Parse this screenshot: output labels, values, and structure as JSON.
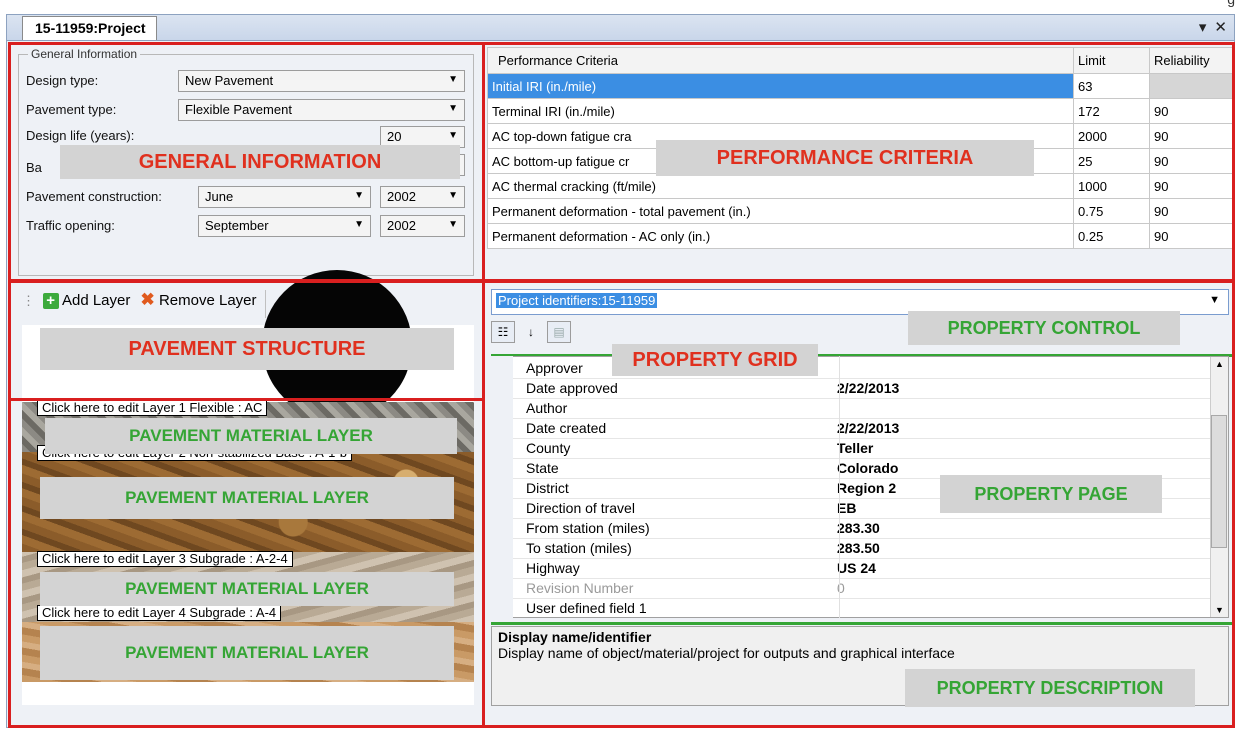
{
  "window": {
    "cut_text": "g",
    "tab_title": "15-11959:Project",
    "tab_menu_icon": "chevron-down-icon",
    "tab_close_icon": "close-icon"
  },
  "general_info": {
    "group_title": "General Information",
    "design_type_label": "Design type:",
    "design_type_value": "New Pavement",
    "pavement_type_label": "Pavement type:",
    "pavement_type_value": "Flexible Pavement",
    "design_life_label": "Design life (years):",
    "design_life_value": "20",
    "base_label_partial": "Ba",
    "construction_label": "Pavement construction:",
    "construction_month": "June",
    "construction_year": "2002",
    "traffic_label": "Traffic opening:",
    "traffic_month": "September",
    "traffic_year": "2002"
  },
  "performance": {
    "headers": [
      "Performance Criteria",
      "Limit",
      "Reliability"
    ],
    "rows": [
      {
        "criteria": "Initial IRI  (in./mile)",
        "limit": "63",
        "reliability": ""
      },
      {
        "criteria": "Terminal IRI (in./mile)",
        "limit": "172",
        "reliability": "90"
      },
      {
        "criteria": "AC top-down fatigue cra",
        "limit": "2000",
        "reliability": "90"
      },
      {
        "criteria": "AC bottom-up fatigue cr",
        "limit": "25",
        "reliability": "90"
      },
      {
        "criteria": "AC thermal cracking (ft/mile)",
        "limit": "1000",
        "reliability": "90"
      },
      {
        "criteria": "Permanent deformation - total pavement (in.)",
        "limit": "0.75",
        "reliability": "90"
      },
      {
        "criteria": "Permanent deformation - AC only (in.)",
        "limit": "0.25",
        "reliability": "90"
      }
    ]
  },
  "pavement_toolbar": {
    "add_label": "Add Layer",
    "remove_label": "Remove Layer"
  },
  "layers": [
    {
      "tag": "Click here to edit Layer 1 Flexible : AC"
    },
    {
      "tag": "Click here to edit Layer 2 Non-stabilized Base : A-1-b"
    },
    {
      "tag": "Click here to edit Layer 3 Subgrade : A-2-4"
    },
    {
      "tag": "Click here to edit Layer 4 Subgrade : A-4"
    }
  ],
  "project_selector": {
    "value": "Project identifiers:15-11959"
  },
  "property_grid": {
    "rows": [
      {
        "key": "Approver",
        "value": ""
      },
      {
        "key": "Date approved",
        "value": "2/22/2013"
      },
      {
        "key": "Author",
        "value": ""
      },
      {
        "key": "Date created",
        "value": "2/22/2013"
      },
      {
        "key": "County",
        "value": "Teller"
      },
      {
        "key": "State",
        "value": "Colorado"
      },
      {
        "key": "District",
        "value": "Region 2"
      },
      {
        "key": "Direction of travel",
        "value": "EB"
      },
      {
        "key": "From station (miles)",
        "value": "283.30"
      },
      {
        "key": "To station (miles)",
        "value": "283.50"
      },
      {
        "key": "Highway",
        "value": "US 24"
      },
      {
        "key": "Revision Number",
        "value": "0"
      },
      {
        "key": "User defined field 1",
        "value": ""
      }
    ]
  },
  "description": {
    "title": "Display name/identifier",
    "text": "Display name of object/material/project for outputs and graphical interface"
  },
  "annotations": {
    "general_information": "GENERAL INFORMATION",
    "performance_criteria": "PERFORMANCE CRITERIA",
    "pavement_structure": "PAVEMENT STRUCTURE",
    "pavement_material_layer": "PAVEMENT MATERIAL LAYER",
    "property_control": "PROPERTY CONTROL",
    "property_grid": "PROPERTY GRID",
    "property_page": "PROPERTY PAGE",
    "property_description": "PROPERTY DESCRIPTION"
  },
  "colors": {
    "annotation_outline": "#d91f1f",
    "annotation_red_text": "#e0301e",
    "annotation_green_text": "#35a535",
    "selection": "#3b8ee3"
  }
}
